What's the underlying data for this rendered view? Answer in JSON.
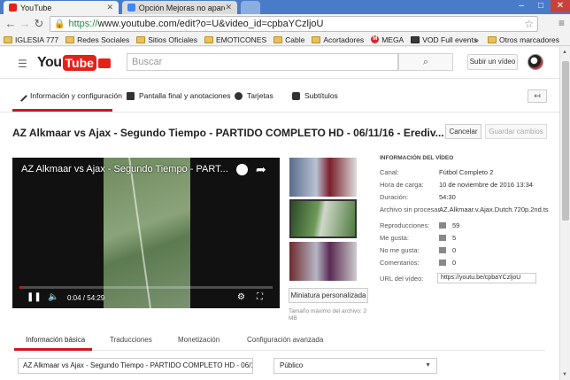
{
  "browser": {
    "tabs": [
      {
        "title": "YouTube",
        "active": true
      },
      {
        "title": "Opción Mejoras no apare",
        "active": false
      }
    ],
    "url_https": "https://",
    "url_rest": "www.youtube.com/edit?o=U&video_id=cpbaYCzljoU",
    "bookmarks": [
      "IGLESIA 777",
      "Redes Sociales",
      "Sitios Oficiales",
      "EMOTICONES",
      "Cable",
      "Acortadores",
      "MEGA",
      "VOD Full events"
    ],
    "bookmarks_more": "»",
    "other_bookmarks": "Otros marcadores"
  },
  "youtube": {
    "logo_you": "You",
    "logo_tube": "Tube",
    "search_placeholder": "Buscar",
    "upload_label": "Subir un vídeo"
  },
  "editor_tabs": [
    {
      "label": "Información y configuración",
      "icon": "pencil-icon",
      "active": true
    },
    {
      "label": "Pantalla final y anotaciones",
      "icon": "film-icon",
      "active": false
    },
    {
      "label": "Tarjetas",
      "icon": "info-icon",
      "active": false
    },
    {
      "label": "Subtítulos",
      "icon": "cc-icon",
      "active": false
    }
  ],
  "video": {
    "title": "AZ Alkmaar vs Ajax - Segundo Tiempo - PARTIDO COMPLETO HD - 06/11/16 - Erediv...",
    "player_title": "AZ Alkmaar vs Ajax - Segundo Tiempo - PART...",
    "timecode": "0:04 / 54:29",
    "progress": 0.0012,
    "cancel_label": "Cancelar",
    "save_label": "Guardar cambios",
    "custom_thumb_label": "Miniatura personalizada",
    "max_size_note": "Tamaño máximo del archivo: 2 MB"
  },
  "info": {
    "header": "INFORMACIÓN DEL VÍDEO",
    "channel_label": "Canal:",
    "channel": "Fútbol Completo 2",
    "upload_time_label": "Hora de carga:",
    "upload_time": "10 de noviembre de 2016 13:34",
    "duration_label": "Duración:",
    "duration": "54:30",
    "raw_file_label": "Archivo sin procesar:",
    "raw_file": "AZ.Alkmaar.v.Ajax.Dutch.720p.2nd.ts",
    "views_label": "Reproducciones:",
    "views": "59",
    "likes_label": "Me gusta:",
    "likes": "5",
    "dislikes_label": "No me gusta:",
    "dislikes": "0",
    "comments_label": "Comentarios:",
    "comments": "0",
    "url_label": "URL del vídeo:",
    "url": "https://youtu.be/cpbaYCzljoU"
  },
  "lower_tabs": [
    "Información básica",
    "Traducciones",
    "Monetización",
    "Configuración avanzada"
  ],
  "basic": {
    "title_value": "AZ Alkmaar vs Ajax - Segundo Tiempo - PARTIDO COMPLETO HD - 06/1",
    "privacy_value": "Público"
  },
  "colors": {
    "accent": "#cc181e",
    "chrome_blue": "#4a7bc8",
    "https_green": "#1e8e3e"
  }
}
